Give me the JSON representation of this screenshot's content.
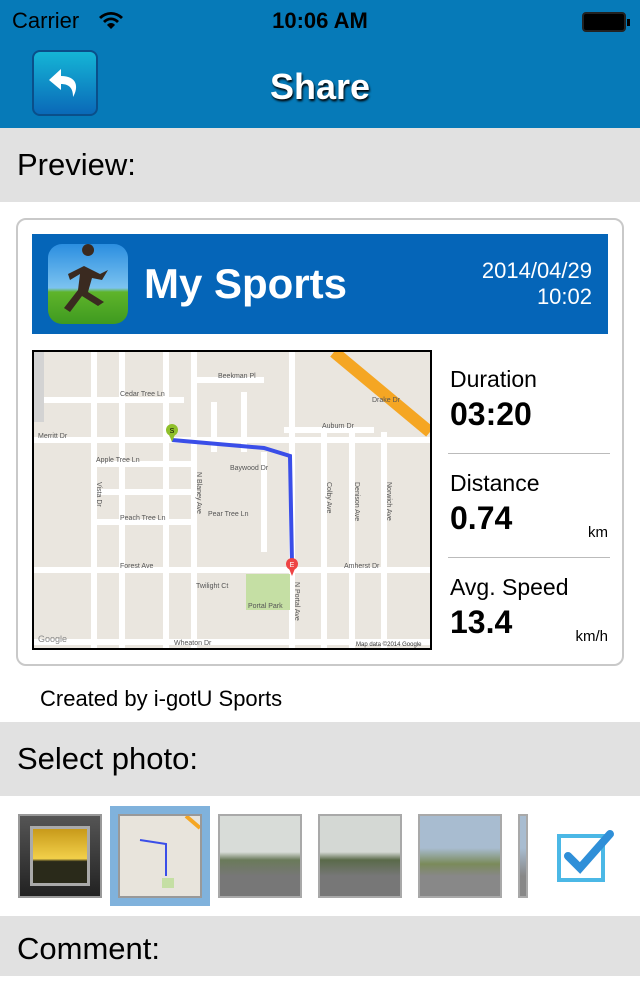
{
  "status_bar": {
    "carrier": "Carrier",
    "time": "10:06 AM",
    "wifi_icon": "wifi-icon",
    "battery_icon": "battery-icon"
  },
  "nav": {
    "title": "Share",
    "back_icon": "back-arrow-icon"
  },
  "preview": {
    "label": "Preview:",
    "app_name": "My Sports",
    "date": "2014/04/29",
    "time": "10:02",
    "stats": [
      {
        "label": "Duration",
        "value": "03:20",
        "unit": ""
      },
      {
        "label": "Distance",
        "value": "0.74",
        "unit": "km"
      },
      {
        "label": "Avg. Speed",
        "value": "13.4",
        "unit": "km/h"
      }
    ],
    "map": {
      "attribution": "Map data ©2014 Google",
      "logo": "Google",
      "start_marker": "S",
      "end_marker": "E",
      "streets": [
        "Cedar Tree Ln",
        "Beekman Pl",
        "Merritt Dr",
        "Auburn Dr",
        "Apple Tree Ln",
        "Baywood Dr",
        "Pear Tree Ln",
        "Peach Tree Ln",
        "Forest Ave",
        "Twilight Ct",
        "Amherst Dr",
        "Portal Park",
        "N Blaney Ave",
        "N Portal Ave",
        "Colby Ave",
        "Denison Ave",
        "Norwich Ave",
        "Drake Dr",
        "Wheaton Dr",
        "Vista Dr"
      ]
    },
    "footer": "Created by i-gotU Sports"
  },
  "select_photo": {
    "label": "Select photo:",
    "selected_index": 1,
    "check_icon": "checkbox-checked-icon",
    "photos": [
      "photo-library",
      "route-map",
      "street-view-1",
      "street-view-2",
      "street-view-3",
      "street-view-4"
    ]
  },
  "comment": {
    "label": "Comment:"
  },
  "colors": {
    "nav": "#067ab8",
    "banner": "#0565b8",
    "route": "#3a4ee8",
    "selection": "#80b2dc"
  }
}
